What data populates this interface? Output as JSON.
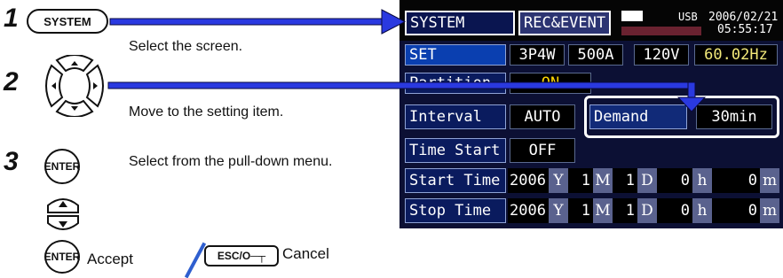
{
  "steps": [
    {
      "number": "1",
      "key_label": "SYSTEM",
      "description": "Select the screen."
    },
    {
      "number": "2",
      "description": "Move to the setting item."
    },
    {
      "number": "3",
      "key_label": "ENTER",
      "description": "Select from the pull-down menu."
    }
  ],
  "accept": {
    "key_label": "ENTER",
    "text": "Accept"
  },
  "cancel": {
    "key_label": "ESC/O─┬",
    "text": "Cancel"
  },
  "screen": {
    "tabs": [
      "SYSTEM",
      "REC&EVENT"
    ],
    "status": {
      "usb": "USB",
      "date": "2006/02/21",
      "time": "05:55:17"
    },
    "set_row": {
      "label": "SET",
      "wiring": "3P4W",
      "current": "500A",
      "voltage": "120V",
      "frequency": "60.02Hz"
    },
    "partition_row": {
      "label": "Partition",
      "value": "ON"
    },
    "interval_row": {
      "label": "Interval",
      "value": "AUTO",
      "demand_label": "Demand",
      "demand_value": "30min"
    },
    "time_start_row": {
      "label": "Time Start",
      "value": "OFF"
    },
    "start_time_row": {
      "label": "Start Time",
      "year": "2006",
      "month": "1",
      "day": "1",
      "hour": "0",
      "minute": "0"
    },
    "stop_time_row": {
      "label": "Stop Time",
      "year": "2006",
      "month": "1",
      "day": "1",
      "hour": "0",
      "minute": "0"
    },
    "units": {
      "year": "Y",
      "month": "M",
      "day": "D",
      "hour": "h",
      "minute": "m"
    }
  },
  "colors": {
    "arrow": "#2a39e0",
    "highlight_border": "#ffffff",
    "screen_bg": "#0c1034",
    "frequency_text": "#f3ea7a",
    "partition_value": "#ffd800"
  }
}
